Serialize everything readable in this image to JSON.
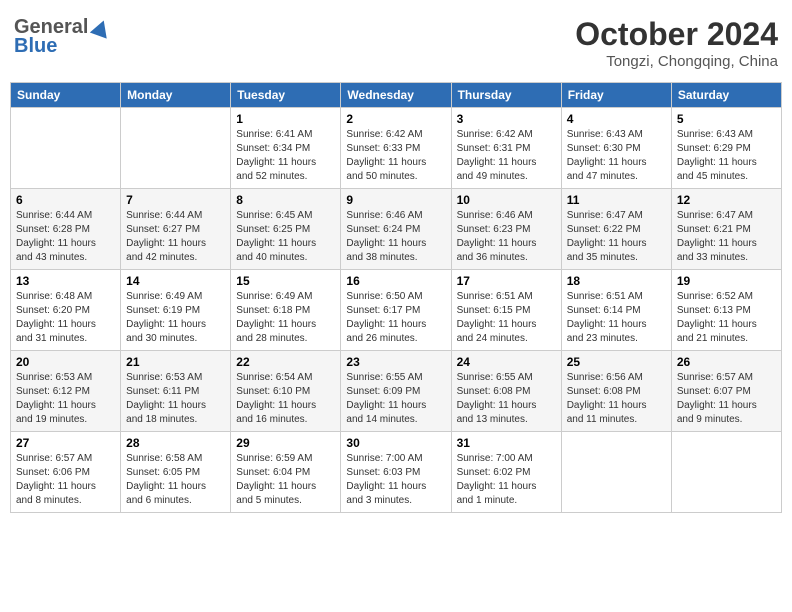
{
  "header": {
    "logo_general": "General",
    "logo_blue": "Blue",
    "month_title": "October 2024",
    "location": "Tongzi, Chongqing, China"
  },
  "weekdays": [
    "Sunday",
    "Monday",
    "Tuesday",
    "Wednesday",
    "Thursday",
    "Friday",
    "Saturday"
  ],
  "weeks": [
    [
      {
        "day": "",
        "info": ""
      },
      {
        "day": "",
        "info": ""
      },
      {
        "day": "1",
        "info": "Sunrise: 6:41 AM\nSunset: 6:34 PM\nDaylight: 11 hours and 52 minutes."
      },
      {
        "day": "2",
        "info": "Sunrise: 6:42 AM\nSunset: 6:33 PM\nDaylight: 11 hours and 50 minutes."
      },
      {
        "day": "3",
        "info": "Sunrise: 6:42 AM\nSunset: 6:31 PM\nDaylight: 11 hours and 49 minutes."
      },
      {
        "day": "4",
        "info": "Sunrise: 6:43 AM\nSunset: 6:30 PM\nDaylight: 11 hours and 47 minutes."
      },
      {
        "day": "5",
        "info": "Sunrise: 6:43 AM\nSunset: 6:29 PM\nDaylight: 11 hours and 45 minutes."
      }
    ],
    [
      {
        "day": "6",
        "info": "Sunrise: 6:44 AM\nSunset: 6:28 PM\nDaylight: 11 hours and 43 minutes."
      },
      {
        "day": "7",
        "info": "Sunrise: 6:44 AM\nSunset: 6:27 PM\nDaylight: 11 hours and 42 minutes."
      },
      {
        "day": "8",
        "info": "Sunrise: 6:45 AM\nSunset: 6:25 PM\nDaylight: 11 hours and 40 minutes."
      },
      {
        "day": "9",
        "info": "Sunrise: 6:46 AM\nSunset: 6:24 PM\nDaylight: 11 hours and 38 minutes."
      },
      {
        "day": "10",
        "info": "Sunrise: 6:46 AM\nSunset: 6:23 PM\nDaylight: 11 hours and 36 minutes."
      },
      {
        "day": "11",
        "info": "Sunrise: 6:47 AM\nSunset: 6:22 PM\nDaylight: 11 hours and 35 minutes."
      },
      {
        "day": "12",
        "info": "Sunrise: 6:47 AM\nSunset: 6:21 PM\nDaylight: 11 hours and 33 minutes."
      }
    ],
    [
      {
        "day": "13",
        "info": "Sunrise: 6:48 AM\nSunset: 6:20 PM\nDaylight: 11 hours and 31 minutes."
      },
      {
        "day": "14",
        "info": "Sunrise: 6:49 AM\nSunset: 6:19 PM\nDaylight: 11 hours and 30 minutes."
      },
      {
        "day": "15",
        "info": "Sunrise: 6:49 AM\nSunset: 6:18 PM\nDaylight: 11 hours and 28 minutes."
      },
      {
        "day": "16",
        "info": "Sunrise: 6:50 AM\nSunset: 6:17 PM\nDaylight: 11 hours and 26 minutes."
      },
      {
        "day": "17",
        "info": "Sunrise: 6:51 AM\nSunset: 6:15 PM\nDaylight: 11 hours and 24 minutes."
      },
      {
        "day": "18",
        "info": "Sunrise: 6:51 AM\nSunset: 6:14 PM\nDaylight: 11 hours and 23 minutes."
      },
      {
        "day": "19",
        "info": "Sunrise: 6:52 AM\nSunset: 6:13 PM\nDaylight: 11 hours and 21 minutes."
      }
    ],
    [
      {
        "day": "20",
        "info": "Sunrise: 6:53 AM\nSunset: 6:12 PM\nDaylight: 11 hours and 19 minutes."
      },
      {
        "day": "21",
        "info": "Sunrise: 6:53 AM\nSunset: 6:11 PM\nDaylight: 11 hours and 18 minutes."
      },
      {
        "day": "22",
        "info": "Sunrise: 6:54 AM\nSunset: 6:10 PM\nDaylight: 11 hours and 16 minutes."
      },
      {
        "day": "23",
        "info": "Sunrise: 6:55 AM\nSunset: 6:09 PM\nDaylight: 11 hours and 14 minutes."
      },
      {
        "day": "24",
        "info": "Sunrise: 6:55 AM\nSunset: 6:08 PM\nDaylight: 11 hours and 13 minutes."
      },
      {
        "day": "25",
        "info": "Sunrise: 6:56 AM\nSunset: 6:08 PM\nDaylight: 11 hours and 11 minutes."
      },
      {
        "day": "26",
        "info": "Sunrise: 6:57 AM\nSunset: 6:07 PM\nDaylight: 11 hours and 9 minutes."
      }
    ],
    [
      {
        "day": "27",
        "info": "Sunrise: 6:57 AM\nSunset: 6:06 PM\nDaylight: 11 hours and 8 minutes."
      },
      {
        "day": "28",
        "info": "Sunrise: 6:58 AM\nSunset: 6:05 PM\nDaylight: 11 hours and 6 minutes."
      },
      {
        "day": "29",
        "info": "Sunrise: 6:59 AM\nSunset: 6:04 PM\nDaylight: 11 hours and 5 minutes."
      },
      {
        "day": "30",
        "info": "Sunrise: 7:00 AM\nSunset: 6:03 PM\nDaylight: 11 hours and 3 minutes."
      },
      {
        "day": "31",
        "info": "Sunrise: 7:00 AM\nSunset: 6:02 PM\nDaylight: 11 hours and 1 minute."
      },
      {
        "day": "",
        "info": ""
      },
      {
        "day": "",
        "info": ""
      }
    ]
  ]
}
